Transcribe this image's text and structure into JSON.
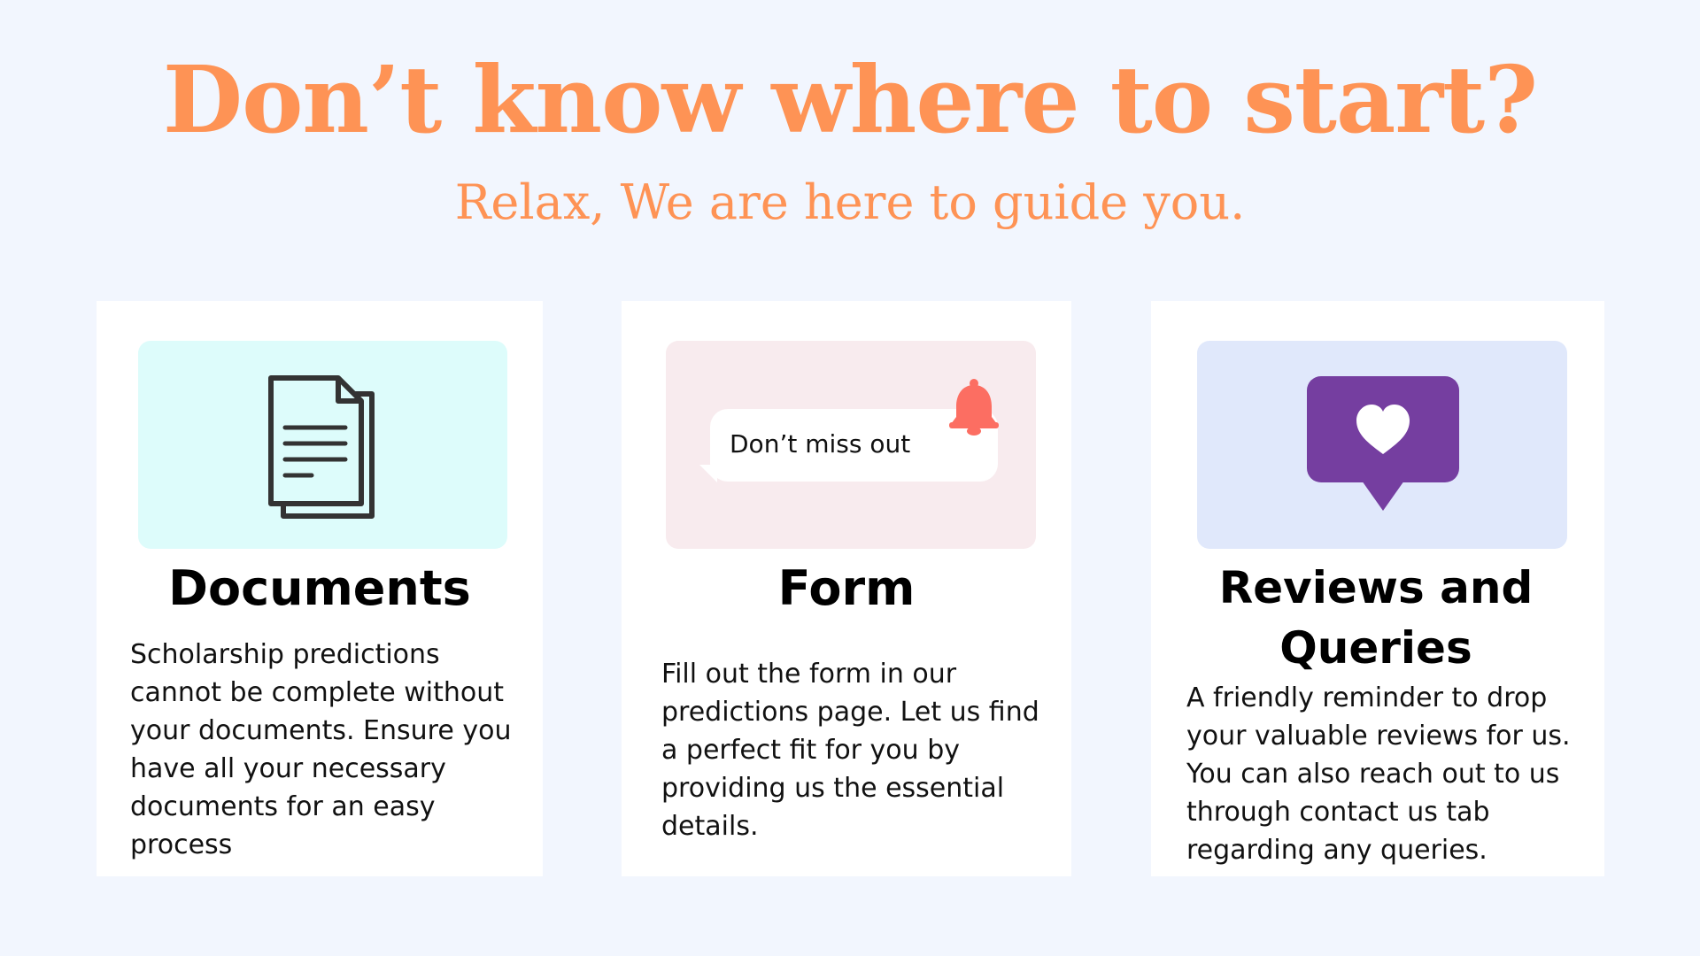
{
  "header": {
    "title": "Don’t know where to start?",
    "subtitle": "Relax, We are here to guide you."
  },
  "cards": [
    {
      "title": "Documents",
      "body": "Scholarship predictions cannot be complete without your documents. Ensure you have all  your necessary documents for an easy process",
      "icon": "document-icon",
      "media_color": "#ddfcfb"
    },
    {
      "title": "Form",
      "body": "Fill out the form in our predictions page. Let us find a perfect fit for you by providing us the essential details.",
      "icon": "bell-icon",
      "notification_text": "Don’t miss out",
      "media_color": "#f8ebee"
    },
    {
      "title": "Reviews and Queries",
      "body": "A friendly reminder to drop your valuable reviews for us. You can also reach out to us through contact us tab regarding any queries.",
      "icon": "heart-message-icon",
      "media_color": "#e0e8fb"
    }
  ],
  "colors": {
    "background": "#f2f6fe",
    "accent": "#fe9355",
    "bell": "#fc6e62",
    "heart_box": "#753ea0"
  }
}
